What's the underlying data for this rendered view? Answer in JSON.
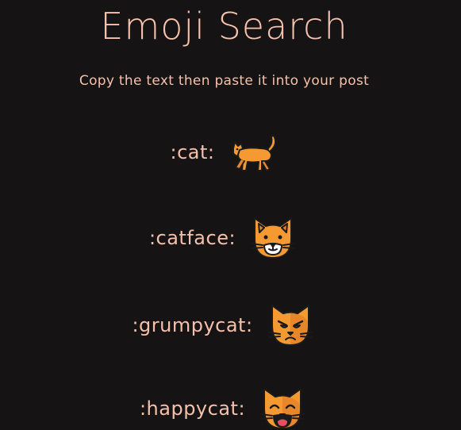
{
  "page": {
    "title": "Emoji Search",
    "subtitle": "Copy the text then paste it into your post"
  },
  "emojis": [
    {
      "code": ":cat:",
      "icon": "cat-icon"
    },
    {
      "code": ":catface:",
      "icon": "cat-face-icon"
    },
    {
      "code": ":grumpycat:",
      "icon": "grumpy-cat-icon"
    },
    {
      "code": ":happycat:",
      "icon": "happy-cat-icon"
    }
  ],
  "colors": {
    "background": "#151314",
    "text": "#f6c1aa",
    "cat_orange": "#f59a33",
    "cat_outline": "#1a1a1a"
  }
}
